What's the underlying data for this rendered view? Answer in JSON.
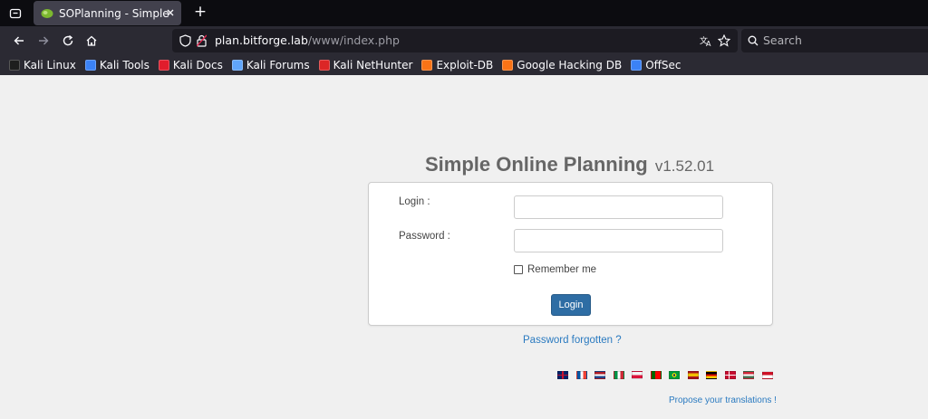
{
  "browser": {
    "tab": {
      "title": "SOPlanning - Simple Onli"
    },
    "url": {
      "host": "plan.bitforge.lab",
      "path": "/www/index.php"
    },
    "search": {
      "placeholder": "Search"
    },
    "bookmarks": [
      {
        "label": "Kali Linux",
        "icon": "kali-dragon-icon",
        "color": "#1e1e1e"
      },
      {
        "label": "Kali Tools",
        "icon": "kali-tools-icon",
        "color": "#3b82f6"
      },
      {
        "label": "Kali Docs",
        "icon": "kali-docs-icon",
        "color": "#e11d2c"
      },
      {
        "label": "Kali Forums",
        "icon": "kali-forums-icon",
        "color": "#60a5fa"
      },
      {
        "label": "Kali NetHunter",
        "icon": "kali-nethunter-icon",
        "color": "#dc2626"
      },
      {
        "label": "Exploit-DB",
        "icon": "exploit-db-icon",
        "color": "#f97316"
      },
      {
        "label": "Google Hacking DB",
        "icon": "ghdb-icon",
        "color": "#f97316"
      },
      {
        "label": "OffSec",
        "icon": "offsec-icon",
        "color": "#3b82f6"
      }
    ]
  },
  "app": {
    "title": "Simple Online Planning",
    "version": "v1.52.01"
  },
  "form": {
    "login_label": "Login :",
    "login_value": "",
    "password_label": "Password :",
    "password_value": "",
    "remember_label": "Remember me",
    "submit_label": "Login"
  },
  "links": {
    "forgot": "Password forgotten ?",
    "translations": "Propose your translations !"
  },
  "flags": [
    "en",
    "fr",
    "nl",
    "it",
    "pl",
    "pt",
    "br",
    "es",
    "de",
    "dk",
    "hu",
    "id"
  ],
  "colors": {
    "primary_button": "#2e6da4",
    "link": "#2a7ac0",
    "title": "#666666"
  }
}
